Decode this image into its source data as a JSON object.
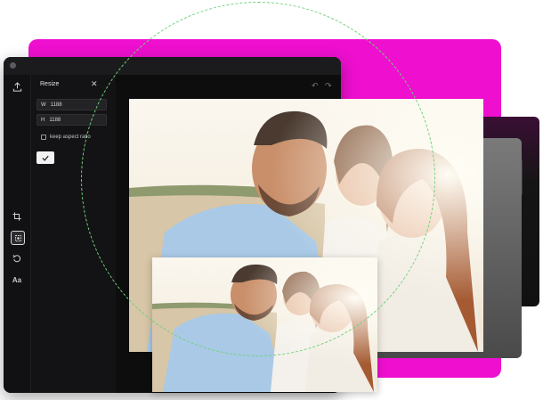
{
  "editor": {
    "panel_title": "Resize",
    "width_label": "W",
    "width_value": "1188",
    "height_label": "H",
    "height_value": "1188",
    "aspect_label": "keep aspect ratio",
    "apply_icon": "check-icon",
    "tools": [
      "upload-icon",
      "crop-icon",
      "resize-icon",
      "rotate-icon",
      "text-icon"
    ],
    "text_tool_label": "Aa"
  },
  "colors": {
    "accent": "#ee0fcf",
    "circle": "#6fd37a",
    "editor_bg": "#0d0d0e"
  }
}
